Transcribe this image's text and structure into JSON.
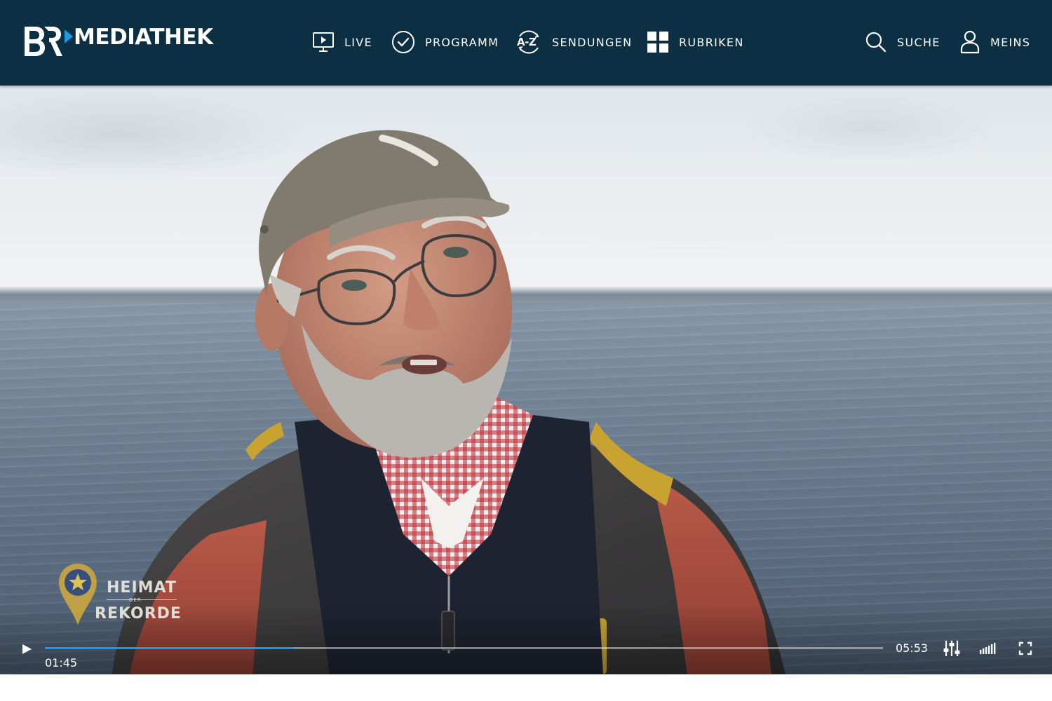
{
  "header": {
    "logo": {
      "brand": "BR",
      "title": "MEDIATHEK"
    },
    "nav": {
      "live": {
        "label": "LIVE",
        "icon": "tv-play-icon"
      },
      "programm": {
        "label": "PROGRAMM",
        "icon": "clock-icon"
      },
      "sendungen": {
        "label": "SENDUNGEN",
        "icon_text": "A-Z",
        "icon": "a-z-icon"
      },
      "rubriken": {
        "label": "RUBRIKEN",
        "icon": "grid-icon"
      }
    },
    "actions": {
      "suche": {
        "label": "SUCHE",
        "icon": "search-icon"
      },
      "meins": {
        "label": "MEINS",
        "icon": "user-icon"
      }
    },
    "colors": {
      "background": "#0c2f44",
      "text": "#ffffff"
    }
  },
  "player": {
    "watermark": {
      "line1": "HEIMAT",
      "small": "DER",
      "line2": "REKORDE"
    },
    "current_time": "01:45",
    "total_time": "05:53",
    "progress_fraction": 0.297,
    "progress_color": "#1e9be0",
    "icons": {
      "play": "play-icon",
      "settings": "settings-sliders-icon",
      "volume": "volume-bars-icon",
      "fullscreen": "fullscreen-icon"
    }
  }
}
